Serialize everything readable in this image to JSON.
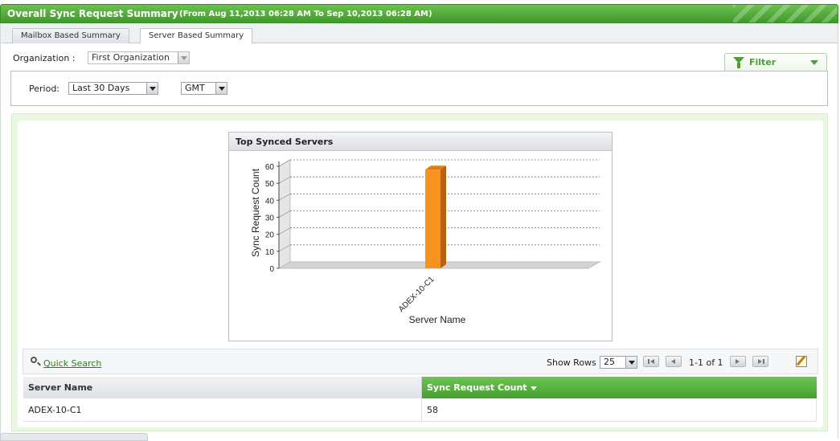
{
  "header": {
    "title": "Overall Sync Request Summary",
    "range": "(From Aug 11,2013 06:28 AM To Sep 10,2013 06:28 AM)"
  },
  "tabs": [
    {
      "label": "Mailbox Based Summary",
      "active": false
    },
    {
      "label": "Server Based Summary",
      "active": true
    }
  ],
  "filters": {
    "organization_label": "Organization :",
    "organization_value": "First Organization",
    "filter_label": "Filter",
    "period_label": "Period:",
    "period_value": "Last 30 Days",
    "timezone_value": "GMT"
  },
  "chart_data": {
    "type": "bar",
    "title": "Top Synced Servers",
    "xlabel": "Server Name",
    "ylabel": "Sync Request Count",
    "categories": [
      "ADEX-10-C1"
    ],
    "values": [
      58
    ],
    "ylim": [
      0,
      60
    ],
    "yticks": [
      "0",
      "10",
      "20",
      "30",
      "40",
      "50",
      "60"
    ],
    "grid": true,
    "bar_color": "#f7931e"
  },
  "grid": {
    "quick_search": "Quick Search",
    "show_rows_label": "Show Rows",
    "rows_value": "25",
    "page_info": "1-1 of 1",
    "columns": [
      "Server Name",
      "Sync Request Count"
    ],
    "rows": [
      [
        "ADEX-10-C1",
        "58"
      ]
    ]
  },
  "colors": {
    "brand_green": "#4aa033",
    "bar_orange": "#f7931e"
  }
}
